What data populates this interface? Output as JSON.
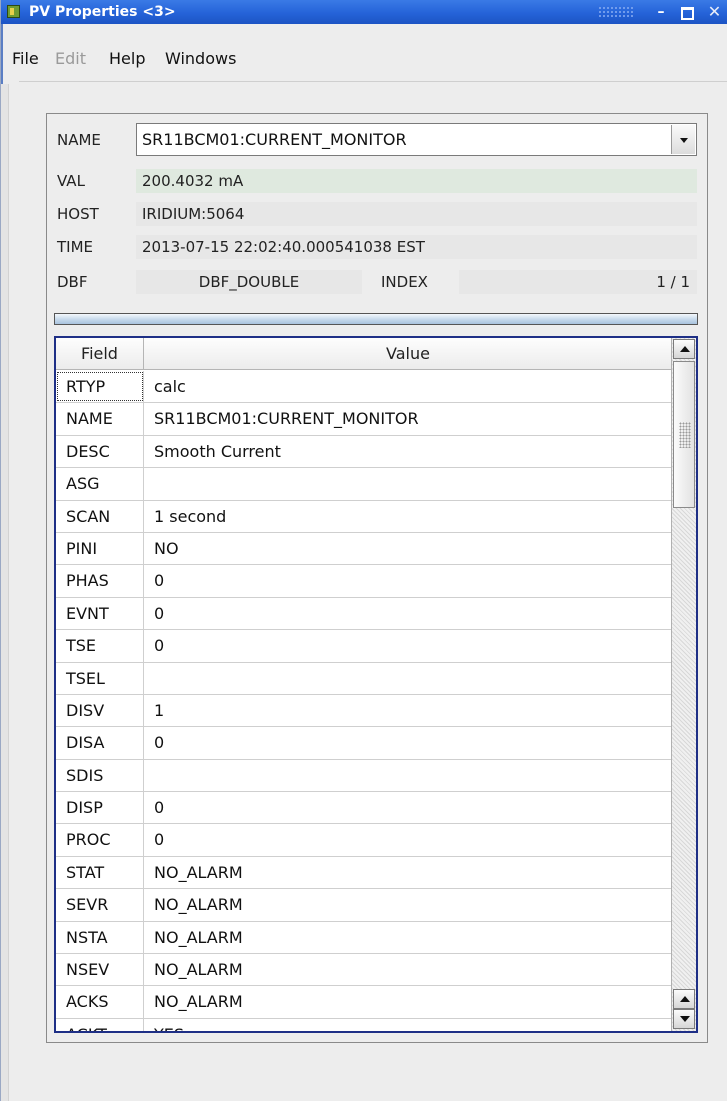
{
  "window": {
    "title": "PV Properties <3>"
  },
  "menu": {
    "file": "File",
    "edit": "Edit",
    "help": "Help",
    "windows": "Windows"
  },
  "pv": {
    "name_label": "NAME",
    "name_value": "SR11BCM01:CURRENT_MONITOR",
    "val_label": "VAL",
    "val_value": "200.4032 mA",
    "host_label": "HOST",
    "host_value": "IRIDIUM:5064",
    "time_label": "TIME",
    "time_value": "2013-07-15 22:02:40.000541038  EST",
    "dbf_label": "DBF",
    "dbf_value": "DBF_DOUBLE",
    "index_label": "INDEX",
    "index_value": "1 / 1"
  },
  "table": {
    "columns": [
      "Field",
      "Value"
    ],
    "rows": [
      {
        "field": "RTYP",
        "value": "calc"
      },
      {
        "field": "NAME",
        "value": "SR11BCM01:CURRENT_MONITOR"
      },
      {
        "field": "DESC",
        "value": "Smooth Current"
      },
      {
        "field": "ASG",
        "value": ""
      },
      {
        "field": "SCAN",
        "value": "1 second"
      },
      {
        "field": "PINI",
        "value": "NO"
      },
      {
        "field": "PHAS",
        "value": "0"
      },
      {
        "field": "EVNT",
        "value": "0"
      },
      {
        "field": "TSE",
        "value": "0"
      },
      {
        "field": "TSEL",
        "value": ""
      },
      {
        "field": "DISV",
        "value": "1"
      },
      {
        "field": "DISA",
        "value": "0"
      },
      {
        "field": "SDIS",
        "value": ""
      },
      {
        "field": "DISP",
        "value": "0"
      },
      {
        "field": "PROC",
        "value": "0"
      },
      {
        "field": "STAT",
        "value": "NO_ALARM"
      },
      {
        "field": "SEVR",
        "value": "NO_ALARM"
      },
      {
        "field": "NSTA",
        "value": "NO_ALARM"
      },
      {
        "field": "NSEV",
        "value": "NO_ALARM"
      },
      {
        "field": "ACKS",
        "value": "NO_ALARM"
      },
      {
        "field": "ACKT",
        "value": "YES"
      }
    ]
  },
  "colors": {
    "titlebar": "#2563d8",
    "table_border": "#1e2f86",
    "val_background": "#dfe9df"
  }
}
